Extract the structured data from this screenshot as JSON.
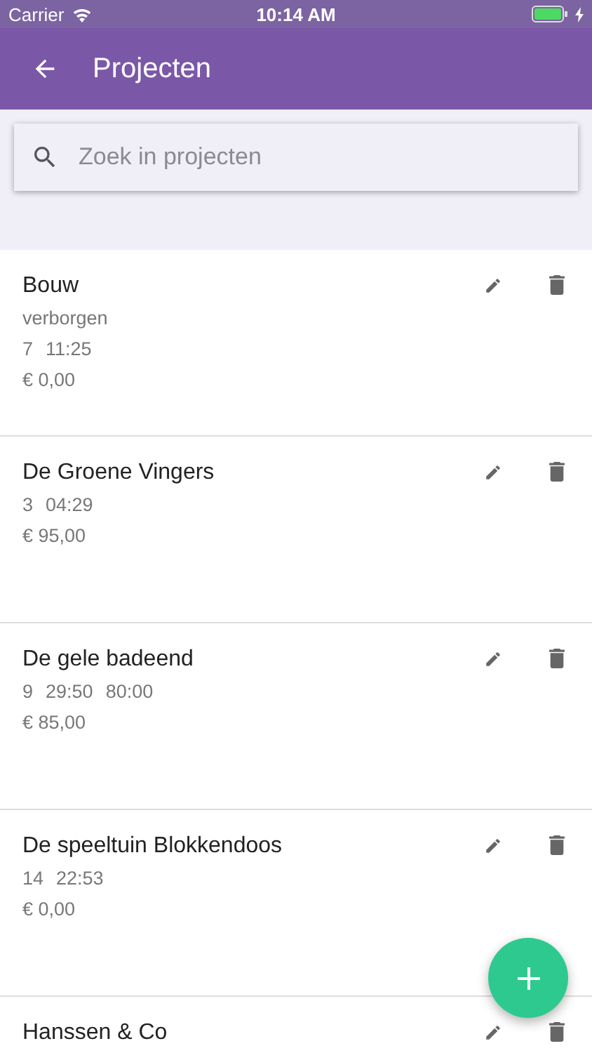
{
  "status_bar": {
    "carrier": "Carrier",
    "time": "10:14 AM"
  },
  "app_bar": {
    "title": "Projecten"
  },
  "search": {
    "placeholder": "Zoek in projecten"
  },
  "projects": [
    {
      "name": "Bouw",
      "subtitle": "verborgen",
      "stats": [
        "7",
        "11:25"
      ],
      "amount": "€ 0,00"
    },
    {
      "name": "De Groene Vingers",
      "stats": [
        "3",
        "04:29"
      ],
      "amount": "€ 95,00"
    },
    {
      "name": "De gele badeend",
      "stats": [
        "9",
        "29:50",
        "80:00"
      ],
      "amount": "€ 85,00"
    },
    {
      "name": "De speeltuin Blokkendoos",
      "stats": [
        "14",
        "22:53"
      ],
      "amount": "€ 0,00"
    },
    {
      "name": "Hanssen & Co"
    }
  ]
}
